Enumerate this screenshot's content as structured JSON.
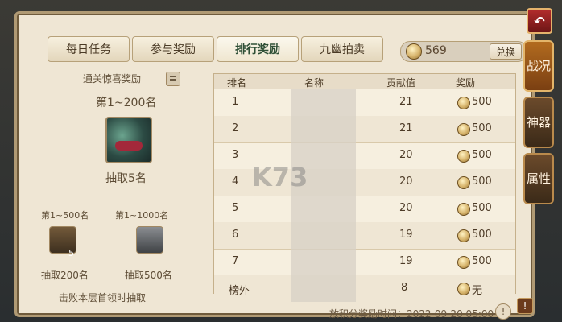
{
  "tabs": [
    {
      "label": "每日任务"
    },
    {
      "label": "参与奖励"
    },
    {
      "label": "排行奖励"
    },
    {
      "label": "九幽拍卖"
    }
  ],
  "currency": {
    "value": "569",
    "exchange_label": "兑换"
  },
  "left": {
    "header": "通关惊喜奖励",
    "rank1_title": "第1~200名",
    "rank1_draw": "抽取5名",
    "rank2_title": "第1~500名",
    "rank3_title": "第1~1000名",
    "rank2_draw": "抽取200名",
    "rank3_draw": "抽取500名",
    "note": "击败本层首领时抽取",
    "item2_count": "5"
  },
  "table": {
    "headers": [
      "排名",
      "名称",
      "贡献值",
      "奖励"
    ],
    "rows": [
      {
        "rank": "1",
        "score": "21",
        "reward": "500"
      },
      {
        "rank": "2",
        "score": "21",
        "reward": "500"
      },
      {
        "rank": "3",
        "score": "20",
        "reward": "500"
      },
      {
        "rank": "4",
        "score": "20",
        "reward": "500"
      },
      {
        "rank": "5",
        "score": "20",
        "reward": "500"
      },
      {
        "rank": "6",
        "score": "19",
        "reward": "500"
      },
      {
        "rank": "7",
        "score": "19",
        "reward": "500"
      },
      {
        "rank": "榜外",
        "score": "8",
        "reward": "无"
      }
    ]
  },
  "footer": "放积分奖励时间：2022-09-20 05:00",
  "side": [
    {
      "label": "战况"
    },
    {
      "label": "神器"
    },
    {
      "label": "属性"
    }
  ],
  "watermark": "K73"
}
